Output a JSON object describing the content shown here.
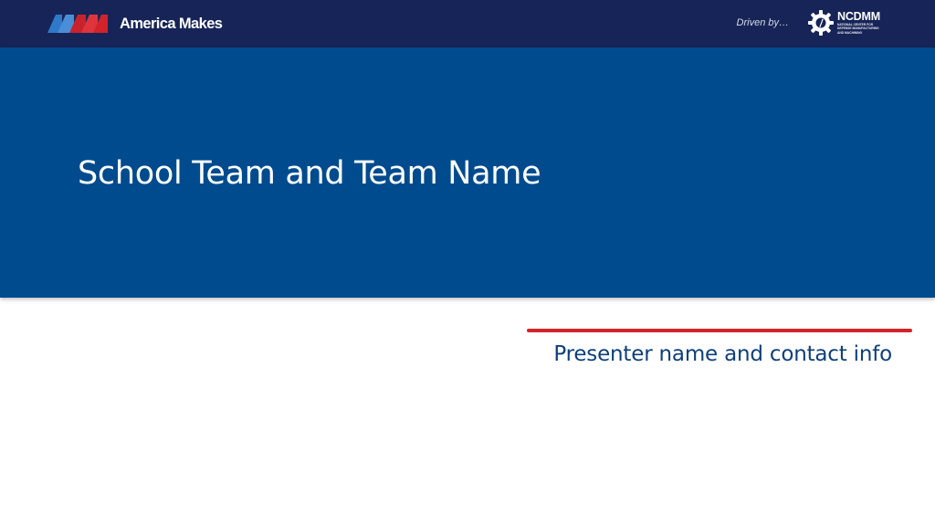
{
  "header": {
    "brand_name": "America Makes",
    "driven_by": "Driven by…",
    "partner_name": "NCDMM",
    "partner_subtitle": "National Center for Defense Manufacturing and Machining",
    "brand_icon": "america-makes-logo-icon",
    "partner_icon": "gear-icon"
  },
  "slide": {
    "title": "School Team and Team Name",
    "presenter": "Presenter name and contact info"
  },
  "colors": {
    "header_bg": "#172457",
    "title_band": "#004b8e",
    "accent_red": "#d2232a",
    "logo_blue": "#2f79c9",
    "text_blue": "#0e3f7a"
  }
}
